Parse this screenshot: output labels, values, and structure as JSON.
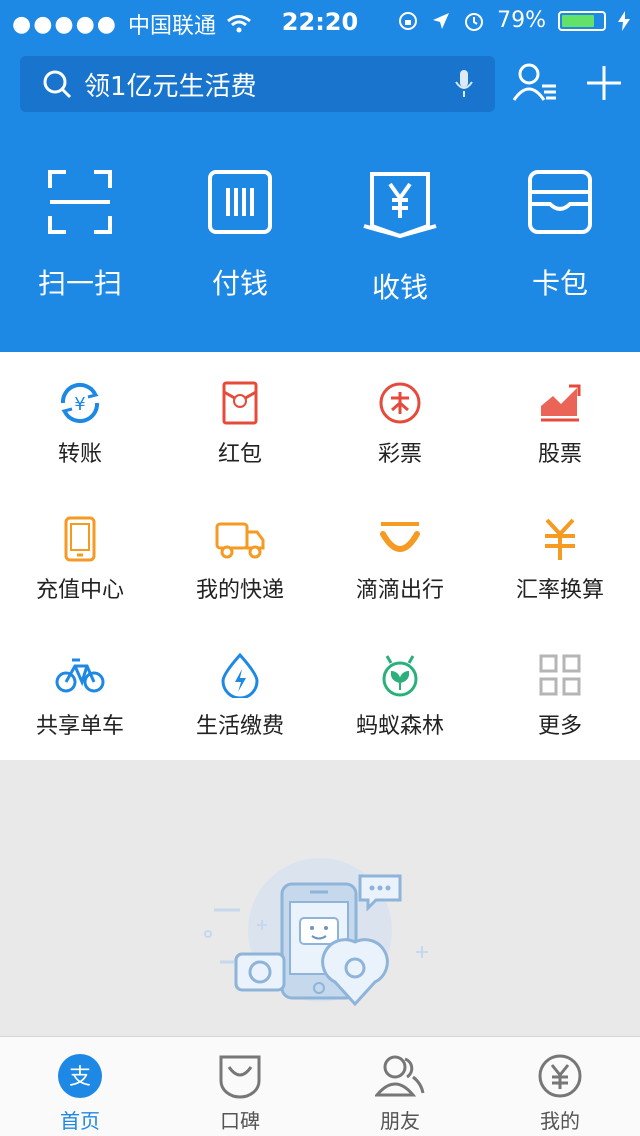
{
  "status": {
    "dots": "●●●●●",
    "carrier": "中国联通",
    "time": "22:20",
    "battery": "79%",
    "battery_level": 0.79
  },
  "search": {
    "placeholder": "领1亿元生活费"
  },
  "quick_actions": [
    {
      "label": "扫一扫",
      "icon": "scan-icon"
    },
    {
      "label": "付钱",
      "icon": "barcode-icon"
    },
    {
      "label": "收钱",
      "icon": "receive-yen-icon"
    },
    {
      "label": "卡包",
      "icon": "wallet-icon"
    }
  ],
  "grid": [
    {
      "label": "转账",
      "icon": "transfer-icon",
      "color": "#1e88e5"
    },
    {
      "label": "红包",
      "icon": "red-envelope-icon",
      "color": "#e64a3b"
    },
    {
      "label": "彩票",
      "icon": "lottery-icon",
      "color": "#e64a3b"
    },
    {
      "label": "股票",
      "icon": "stock-icon",
      "color": "#e64a3b"
    },
    {
      "label": "充值中心",
      "icon": "phone-icon",
      "color": "#f59a23"
    },
    {
      "label": "我的快递",
      "icon": "truck-icon",
      "color": "#f59a23"
    },
    {
      "label": "滴滴出行",
      "icon": "didi-icon",
      "color": "#f59a23"
    },
    {
      "label": "汇率换算",
      "icon": "exchange-icon",
      "color": "#f59a23"
    },
    {
      "label": "共享单车",
      "icon": "bike-icon",
      "color": "#1e88e5"
    },
    {
      "label": "生活缴费",
      "icon": "utility-drop-icon",
      "color": "#1e88e5"
    },
    {
      "label": "蚂蚁森林",
      "icon": "forest-icon",
      "color": "#2bb07c"
    },
    {
      "label": "更多",
      "icon": "more-grid-icon",
      "color": "#b5b5b5"
    }
  ],
  "tabs": [
    {
      "label": "首页",
      "icon": "alipay-icon",
      "active": true
    },
    {
      "label": "口碑",
      "icon": "koubei-icon",
      "active": false
    },
    {
      "label": "朋友",
      "icon": "friends-icon",
      "active": false
    },
    {
      "label": "我的",
      "icon": "my-yen-icon",
      "active": false
    }
  ],
  "colors": {
    "brand": "#1e88e5",
    "search_bg": "#1874cc",
    "tab_active": "#1e88e5"
  }
}
